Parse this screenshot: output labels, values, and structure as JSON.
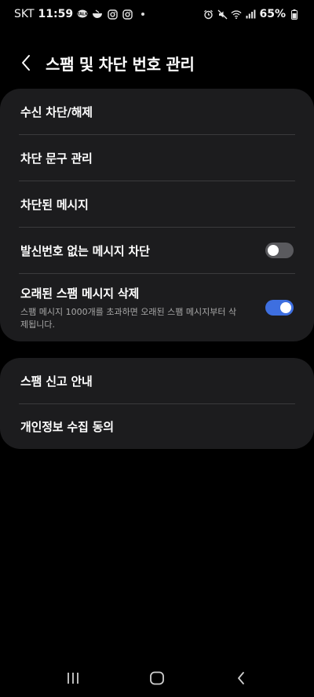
{
  "status_bar": {
    "carrier": "SKT",
    "time": "11:59",
    "battery_percent": "65%",
    "left_icons": [
      "talk-icon",
      "bowl-icon",
      "instagram-icon",
      "instagram-icon",
      "dot"
    ],
    "right_icons": [
      "alarm-icon",
      "mute-icon",
      "wifi-icon",
      "signal-icon",
      "battery-icon"
    ]
  },
  "header": {
    "title": "스팸 및 차단 번호 관리"
  },
  "card1": {
    "items": [
      {
        "label": "수신 차단/해제"
      },
      {
        "label": "차단 문구 관리"
      },
      {
        "label": "차단된 메시지"
      },
      {
        "label": "발신번호 없는 메시지 차단",
        "toggle": false
      },
      {
        "label": "오래된 스팸 메시지 삭제",
        "sub": "스팸 메시지 1000개를 초과하면 오래된 스팸 메시지부터 삭제됩니다.",
        "toggle": true
      }
    ]
  },
  "card2": {
    "items": [
      {
        "label": "스팸 신고 안내"
      },
      {
        "label": "개인정보 수집 동의"
      }
    ]
  },
  "colors": {
    "background": "#000000",
    "card": "#1c1c1e",
    "toggle_on": "#3e6fe0",
    "toggle_off": "#5a5a5e"
  }
}
